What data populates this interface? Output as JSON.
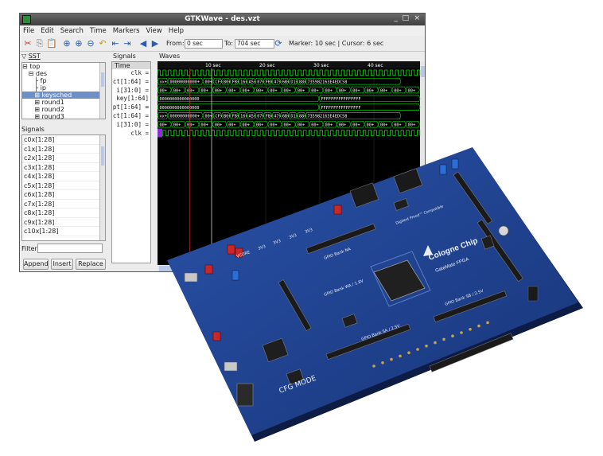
{
  "window": {
    "title": "GTKWave - des.vzt",
    "buttons": [
      "_",
      "□",
      "×"
    ]
  },
  "menu": [
    "File",
    "Edit",
    "Search",
    "Time",
    "Markers",
    "View",
    "Help"
  ],
  "toolbar": {
    "from_label": "From:",
    "from_value": "0 sec",
    "to_label": "To:",
    "to_value": "704 sec",
    "status": "Marker: 10 sec  |  Cursor: 6 sec"
  },
  "sst": {
    "header": "SST",
    "tree": [
      {
        "label": "top",
        "prefix": "⊟ "
      },
      {
        "label": "des",
        "prefix": "   ⊟ "
      },
      {
        "label": "fp",
        "prefix": "      ├ "
      },
      {
        "label": "ip",
        "prefix": "      ├ "
      },
      {
        "label": "keysched",
        "prefix": "      ⊞ ",
        "selected": true
      },
      {
        "label": "round1",
        "prefix": "      ⊞ "
      },
      {
        "label": "round2",
        "prefix": "      ⊞ "
      },
      {
        "label": "round3",
        "prefix": "      ⊞ "
      }
    ],
    "signals_header": "Signals",
    "signals": [
      "c0x[1:28]",
      "c1x[1:28]",
      "c2x[1:28]",
      "c3x[1:28]",
      "c4x[1:28]",
      "c5x[1:28]",
      "c6x[1:28]",
      "c7x[1:28]",
      "c8x[1:28]",
      "c9x[1:28]",
      "c10x[1:28]"
    ],
    "filter_label": "Filter:",
    "buttons": [
      "Append",
      "Insert",
      "Replace"
    ]
  },
  "signals_pane": {
    "header": "Signals",
    "time_label": "Time",
    "names": [
      "clk =",
      "ct[1:64] =",
      "i[31:0] =",
      "key[1:64] =",
      "pt[1:64] =",
      "ct[1:64] =",
      "i[31:0] =",
      "clk ="
    ]
  },
  "waves": {
    "header": "Waves",
    "time_ticks": [
      "10 sec",
      "20 sec",
      "30 sec",
      "40 sec"
    ],
    "ct_values": [
      "xx+",
      "00000000000+",
      "00+",
      "CF+",
      "B0+",
      "FB+",
      "16+",
      "A5+",
      "07+",
      "FB+",
      "47+",
      "6B+",
      "D1+",
      "88+",
      "735982163E4EDC58"
    ],
    "i_values": [
      "00+",
      "00+",
      "00+",
      "00+",
      "00+",
      "00+",
      "00+",
      "00+",
      "00+",
      "00+",
      "00+",
      "00+",
      "00+",
      "00+",
      "00+",
      "00+",
      "00+",
      "00+",
      "00+"
    ],
    "key_values": [
      "0000000000000000",
      "FFFFFFFFFFFFFFFF"
    ],
    "pt_values": [
      "0000000000000000",
      "FFFFFFFFFFFFFFFF"
    ],
    "colors": {
      "clk": "#00e000",
      "bus": "#00d000",
      "marker": "#ffffff",
      "cursor": "#ff4040",
      "bg": "#000000"
    }
  },
  "board": {
    "brand": "Cologne Chip",
    "product": "GateMate FPGA",
    "labels": [
      "VCORE",
      "3V3",
      "3V3",
      "3V3",
      "3V3",
      "GPIO Bank NA",
      "GPIO Bank WA / 1.8V",
      "GPIO Bank SB / 2.5V",
      "GPIO Bank SA / 2.5V",
      "CFG MODE",
      "Digilent Pmod™ Compatible"
    ],
    "colors": {
      "pcb": "#1c3f8f",
      "pcb_dark": "#12295f",
      "silk": "#e8eef8"
    }
  }
}
